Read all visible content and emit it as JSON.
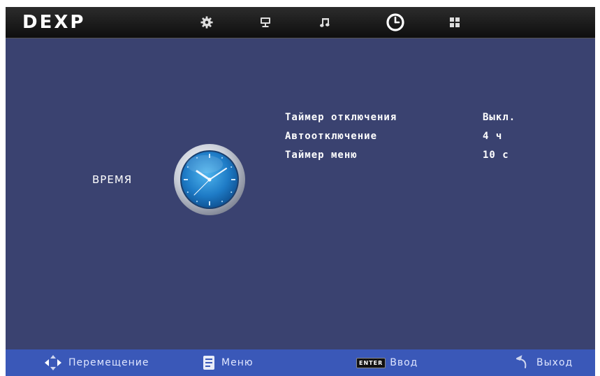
{
  "brand": {
    "logo_text": "DEXP"
  },
  "tabs": [
    {
      "name": "settings-tab",
      "icon": "gear-icon"
    },
    {
      "name": "display-tab",
      "icon": "monitor-icon"
    },
    {
      "name": "sound-tab",
      "icon": "music-note-icon"
    },
    {
      "name": "time-tab",
      "icon": "clock-icon",
      "selected": true
    },
    {
      "name": "apps-tab",
      "icon": "grid-icon"
    }
  ],
  "section": {
    "title": "ВРЕМЯ",
    "icon": "clock-icon"
  },
  "settings": [
    {
      "label": "Таймер отключения",
      "value": "Выкл."
    },
    {
      "label": "Автоотключение",
      "value": "4 ч"
    },
    {
      "label": "Таймер меню",
      "value": "10 с"
    }
  ],
  "footer": {
    "move": {
      "label": "Перемещение",
      "icon": "dpad-arrows-icon"
    },
    "menu": {
      "label": "Меню",
      "icon": "menu-icon"
    },
    "enter": {
      "key": "ENTER",
      "label": "Ввод",
      "icon": "enter-key-icon"
    },
    "exit": {
      "label": "Выход",
      "icon": "return-arrow-icon"
    }
  },
  "colors": {
    "background": "#3a4270",
    "topbar": "#1a1a1a",
    "footer": "#3a58b8",
    "text": "#ffffff"
  }
}
